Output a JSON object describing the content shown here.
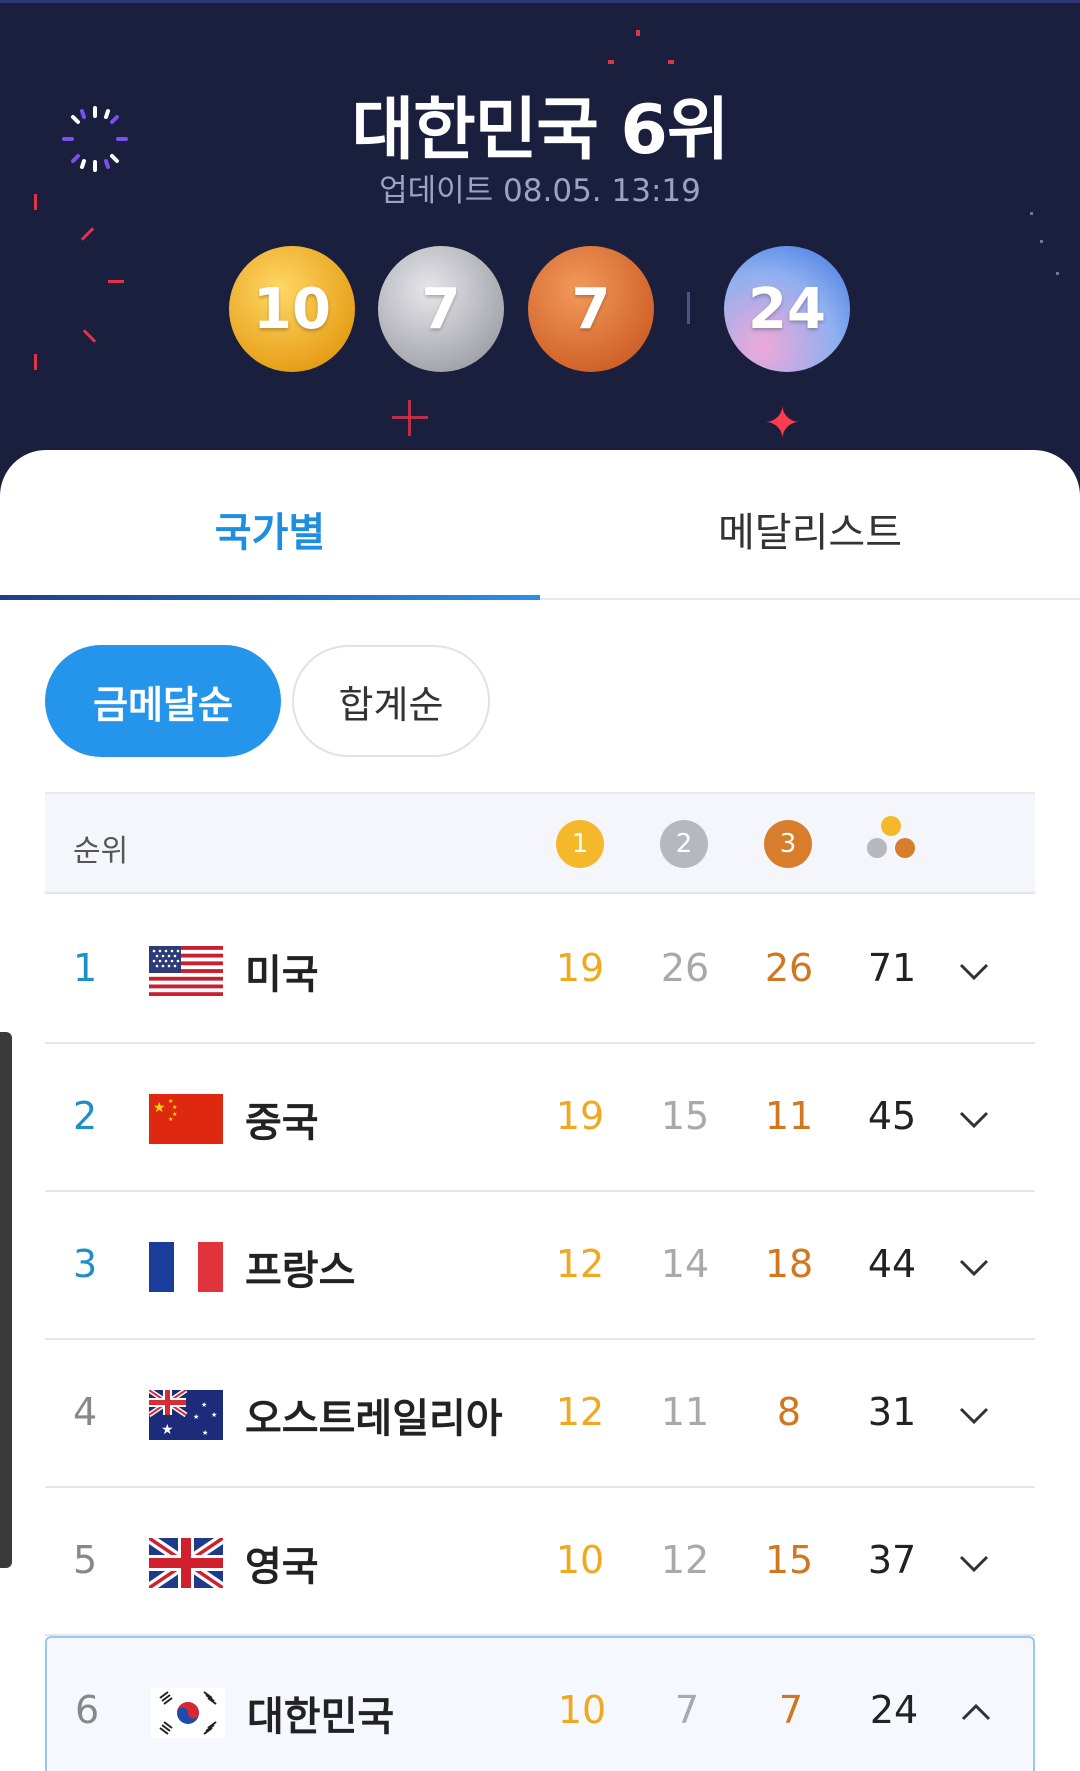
{
  "header": {
    "title": "대한민국 6위",
    "update": "업데이트 08.05. 13:19",
    "medals": {
      "gold": "10",
      "silver": "7",
      "bronze": "7",
      "total": "24"
    }
  },
  "tabs": [
    {
      "label": "국가별",
      "active": true
    },
    {
      "label": "메달리스트",
      "active": false
    }
  ],
  "sort": {
    "gold_order": "금메달순",
    "total_order": "합계순"
  },
  "table": {
    "rank_header": "순위",
    "gold_badge": "1",
    "silver_badge": "2",
    "bronze_badge": "3",
    "rows": [
      {
        "rank": "1",
        "country": "미국",
        "gold": "19",
        "silver": "26",
        "bronze": "26",
        "total": "71",
        "flag": "usa"
      },
      {
        "rank": "2",
        "country": "중국",
        "gold": "19",
        "silver": "15",
        "bronze": "11",
        "total": "45",
        "flag": "china"
      },
      {
        "rank": "3",
        "country": "프랑스",
        "gold": "12",
        "silver": "14",
        "bronze": "18",
        "total": "44",
        "flag": "france"
      },
      {
        "rank": "4",
        "country": "오스트레일리아",
        "gold": "12",
        "silver": "11",
        "bronze": "8",
        "total": "31",
        "flag": "australia"
      },
      {
        "rank": "5",
        "country": "영국",
        "gold": "10",
        "silver": "12",
        "bronze": "15",
        "total": "37",
        "flag": "uk"
      },
      {
        "rank": "6",
        "country": "대한민국",
        "gold": "10",
        "silver": "7",
        "bronze": "7",
        "total": "24",
        "flag": "korea",
        "expanded": true
      }
    ]
  },
  "colors": {
    "header_bg": "#1a1f3d",
    "accent": "#2595ec",
    "gold": "#f0a91e",
    "silver": "#a7a9ad",
    "bronze": "#d0771f"
  }
}
